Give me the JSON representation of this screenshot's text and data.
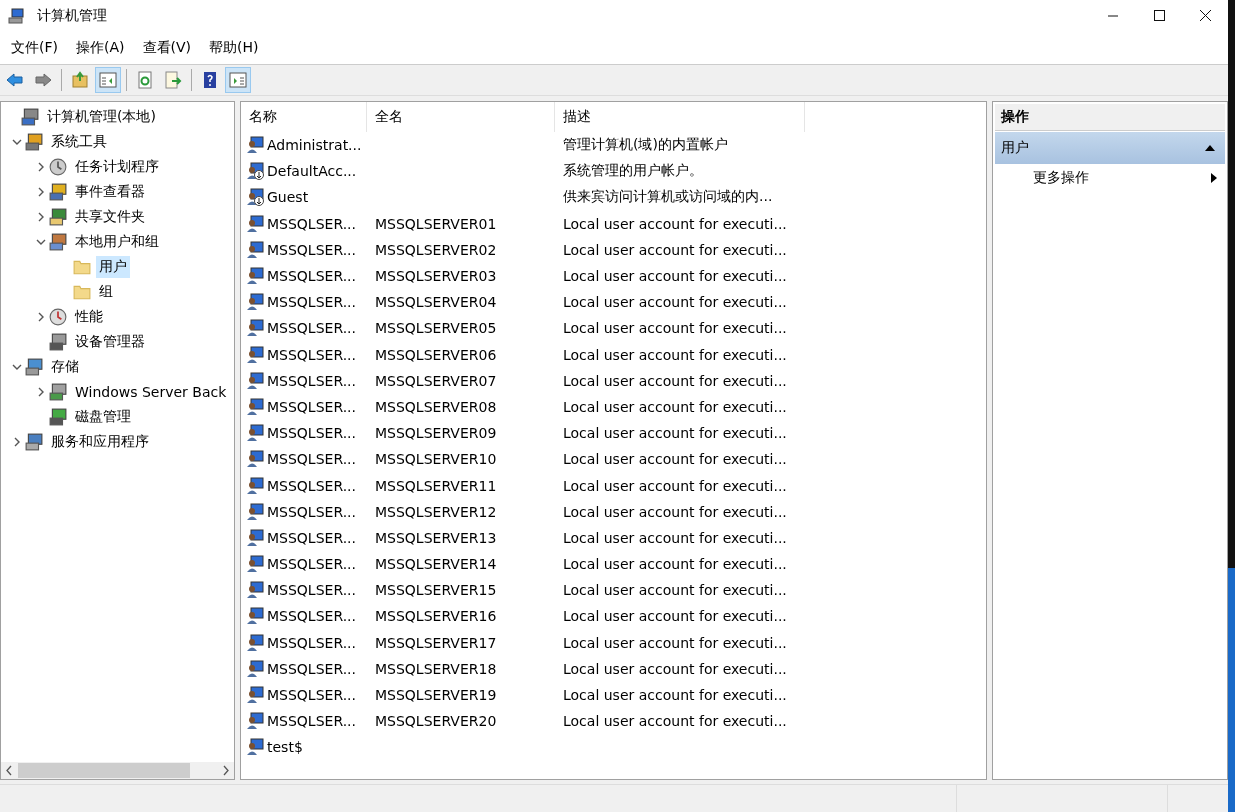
{
  "window": {
    "title": "计算机管理"
  },
  "menu": [
    "文件(F)",
    "操作(A)",
    "查看(V)",
    "帮助(H)"
  ],
  "toolbar": [
    {
      "kind": "back"
    },
    {
      "kind": "forward"
    },
    {
      "kind": "sep"
    },
    {
      "kind": "up"
    },
    {
      "kind": "tree",
      "on": true
    },
    {
      "kind": "sep"
    },
    {
      "kind": "refresh"
    },
    {
      "kind": "export"
    },
    {
      "kind": "sep"
    },
    {
      "kind": "help"
    },
    {
      "kind": "actions",
      "on": true
    }
  ],
  "tree": [
    {
      "label": "计算机管理(本地)",
      "kind": "computer",
      "selected": false,
      "children": [
        {
          "label": "系统工具",
          "kind": "tools",
          "expanded": true,
          "selected": false,
          "children": [
            {
              "label": "任务计划程序",
              "kind": "clock",
              "expanded": false,
              "selected": false
            },
            {
              "label": "事件查看器",
              "kind": "log",
              "expanded": false,
              "selected": false
            },
            {
              "label": "共享文件夹",
              "kind": "share",
              "expanded": false,
              "selected": false
            },
            {
              "label": "本地用户和组",
              "kind": "users",
              "expanded": true,
              "selected": false,
              "children": [
                {
                  "label": "用户",
                  "kind": "folder",
                  "selected": true
                },
                {
                  "label": "组",
                  "kind": "folder",
                  "selected": false
                }
              ]
            },
            {
              "label": "性能",
              "kind": "perf",
              "expanded": false,
              "selected": false
            },
            {
              "label": "设备管理器",
              "kind": "device",
              "selected": false
            }
          ]
        },
        {
          "label": "存储",
          "kind": "storage",
          "expanded": true,
          "selected": false,
          "children": [
            {
              "label": "Windows Server Back",
              "kind": "backup",
              "expanded": false,
              "selected": false
            },
            {
              "label": "磁盘管理",
              "kind": "disk",
              "selected": false
            }
          ]
        },
        {
          "label": "服务和应用程序",
          "kind": "services",
          "expanded": false,
          "selected": false
        }
      ]
    }
  ],
  "table": {
    "columns": [
      "名称",
      "全名",
      "描述"
    ],
    "rows": [
      {
        "name": "Administrat...",
        "full_name": "",
        "description": "管理计算机(域)的内置帐户",
        "kind": "user"
      },
      {
        "name": "DefaultAcc...",
        "full_name": "",
        "description": "系统管理的用户帐户。",
        "kind": "disabled"
      },
      {
        "name": "Guest",
        "full_name": "",
        "description": "供来宾访问计算机或访问域的内...",
        "kind": "disabled"
      },
      {
        "name": "MSSQLSER...",
        "full_name": "MSSQLSERVER01",
        "description": "Local user account for executi...",
        "kind": "user"
      },
      {
        "name": "MSSQLSER...",
        "full_name": "MSSQLSERVER02",
        "description": "Local user account for executi...",
        "kind": "user"
      },
      {
        "name": "MSSQLSER...",
        "full_name": "MSSQLSERVER03",
        "description": "Local user account for executi...",
        "kind": "user"
      },
      {
        "name": "MSSQLSER...",
        "full_name": "MSSQLSERVER04",
        "description": "Local user account for executi...",
        "kind": "user"
      },
      {
        "name": "MSSQLSER...",
        "full_name": "MSSQLSERVER05",
        "description": "Local user account for executi...",
        "kind": "user"
      },
      {
        "name": "MSSQLSER...",
        "full_name": "MSSQLSERVER06",
        "description": "Local user account for executi...",
        "kind": "user"
      },
      {
        "name": "MSSQLSER...",
        "full_name": "MSSQLSERVER07",
        "description": "Local user account for executi...",
        "kind": "user"
      },
      {
        "name": "MSSQLSER...",
        "full_name": "MSSQLSERVER08",
        "description": "Local user account for executi...",
        "kind": "user"
      },
      {
        "name": "MSSQLSER...",
        "full_name": "MSSQLSERVER09",
        "description": "Local user account for executi...",
        "kind": "user"
      },
      {
        "name": "MSSQLSER...",
        "full_name": "MSSQLSERVER10",
        "description": "Local user account for executi...",
        "kind": "user"
      },
      {
        "name": "MSSQLSER...",
        "full_name": "MSSQLSERVER11",
        "description": "Local user account for executi...",
        "kind": "user"
      },
      {
        "name": "MSSQLSER...",
        "full_name": "MSSQLSERVER12",
        "description": "Local user account for executi...",
        "kind": "user"
      },
      {
        "name": "MSSQLSER...",
        "full_name": "MSSQLSERVER13",
        "description": "Local user account for executi...",
        "kind": "user"
      },
      {
        "name": "MSSQLSER...",
        "full_name": "MSSQLSERVER14",
        "description": "Local user account for executi...",
        "kind": "user"
      },
      {
        "name": "MSSQLSER...",
        "full_name": "MSSQLSERVER15",
        "description": "Local user account for executi...",
        "kind": "user"
      },
      {
        "name": "MSSQLSER...",
        "full_name": "MSSQLSERVER16",
        "description": "Local user account for executi...",
        "kind": "user"
      },
      {
        "name": "MSSQLSER...",
        "full_name": "MSSQLSERVER17",
        "description": "Local user account for executi...",
        "kind": "user"
      },
      {
        "name": "MSSQLSER...",
        "full_name": "MSSQLSERVER18",
        "description": "Local user account for executi...",
        "kind": "user"
      },
      {
        "name": "MSSQLSER...",
        "full_name": "MSSQLSERVER19",
        "description": "Local user account for executi...",
        "kind": "user"
      },
      {
        "name": "MSSQLSER...",
        "full_name": "MSSQLSERVER20",
        "description": "Local user account for executi...",
        "kind": "user"
      },
      {
        "name": "test$",
        "full_name": "",
        "description": "",
        "kind": "user"
      }
    ]
  },
  "actions": {
    "title": "操作",
    "section": "用户",
    "expanded": true,
    "items": [
      {
        "label": "更多操作",
        "submenu": true
      }
    ]
  }
}
